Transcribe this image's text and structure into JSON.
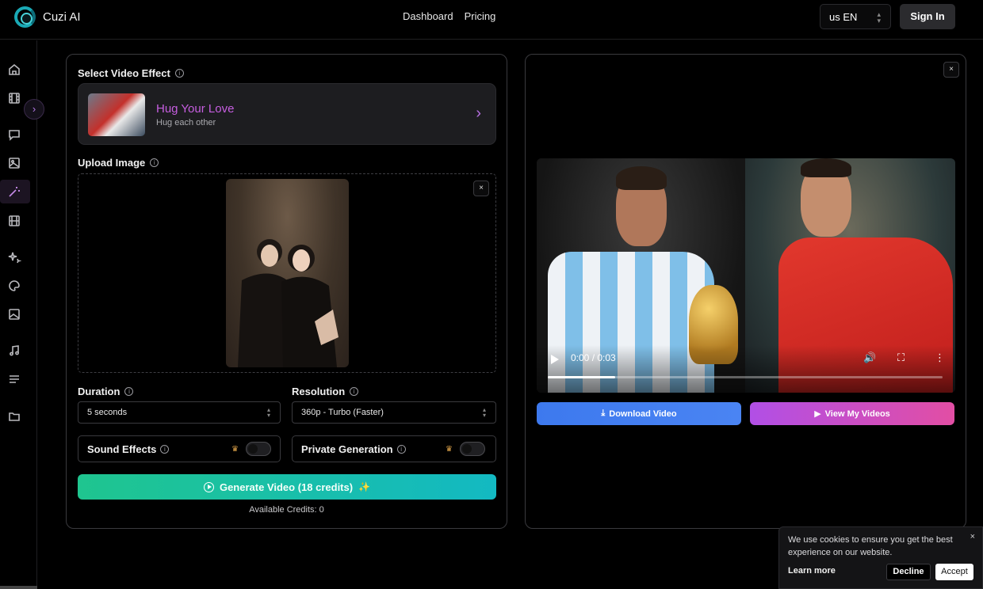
{
  "app": {
    "name": "Cuzi AI"
  },
  "nav": {
    "links": [
      "Dashboard",
      "Pricing"
    ],
    "language": "us EN",
    "sign_in": "Sign In"
  },
  "sidebar": {
    "toggle": "›",
    "icons": [
      "home-icon",
      "film-icon",
      "chat-icon",
      "image-icon",
      "magic-wand-icon",
      "film-strip-icon",
      "sparkles-icon",
      "palette-icon",
      "image-edit-icon",
      "music-icon",
      "list-icon",
      "folder-icon"
    ]
  },
  "effect": {
    "label": "Select Video Effect",
    "title": "Hug Your Love",
    "subtitle": "Hug each other"
  },
  "upload": {
    "label": "Upload Image",
    "close": "×"
  },
  "duration": {
    "label": "Duration",
    "value": "5 seconds"
  },
  "resolution": {
    "label": "Resolution",
    "value": "360p - Turbo (Faster)"
  },
  "sound_effects": {
    "label": "Sound Effects",
    "enabled": false
  },
  "private_generation": {
    "label": "Private Generation",
    "enabled": false
  },
  "generate": {
    "label": "Generate Video (18 credits)",
    "credits_text": "Available Credits: 0"
  },
  "preview": {
    "close": "×",
    "time": "0:00 / 0:03",
    "progress": 0.17,
    "download": "Download Video",
    "view": "View My Videos"
  },
  "cookie": {
    "text": "We use cookies to ensure you get the best experience on our website.",
    "learn_more": "Learn more",
    "decline": "Decline",
    "accept": "Accept",
    "close": "×"
  },
  "colors": {
    "accent_purple": "#c65ee0",
    "generate_start": "#1fc58f",
    "generate_end": "#13b9c2",
    "download": "#3d79ee",
    "view_start": "#b14fe6",
    "view_end": "#e24ea4"
  }
}
